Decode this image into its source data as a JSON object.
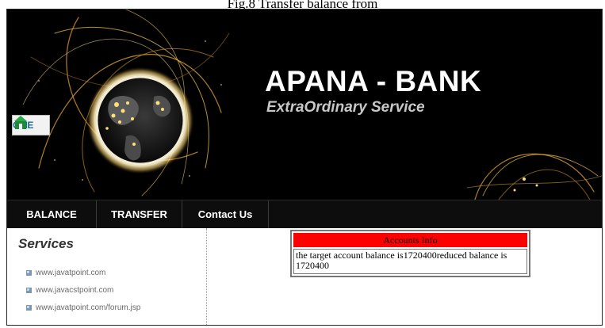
{
  "caption": "Fig.8 Transfer balance from",
  "banner": {
    "title": "APANA - BANK",
    "tagline": "ExtraOrdinary Service",
    "home_label": "OME"
  },
  "nav": {
    "items": [
      {
        "label": "BALANCE"
      },
      {
        "label": "TRANSFER"
      },
      {
        "label": "Contact Us"
      }
    ]
  },
  "sidebar": {
    "heading": "Services",
    "links": [
      {
        "label": "www.javatpoint.com"
      },
      {
        "label": "www.javacstpoint.com"
      },
      {
        "label": "www.javatpoint.com/forum.jsp"
      }
    ]
  },
  "accounts": {
    "heading": "Accounts Info",
    "message": "the target account balance is1720400reduced balance is 1720400"
  },
  "colors": {
    "banner_bg": "#000000",
    "nav_bg": "#0d0d0d",
    "accounts_header": "#ff0000",
    "glow": "#ffd84a"
  },
  "icons": {
    "home": "home-icon",
    "bullet": "link-bullet-icon",
    "globe": "globe-graphic"
  }
}
